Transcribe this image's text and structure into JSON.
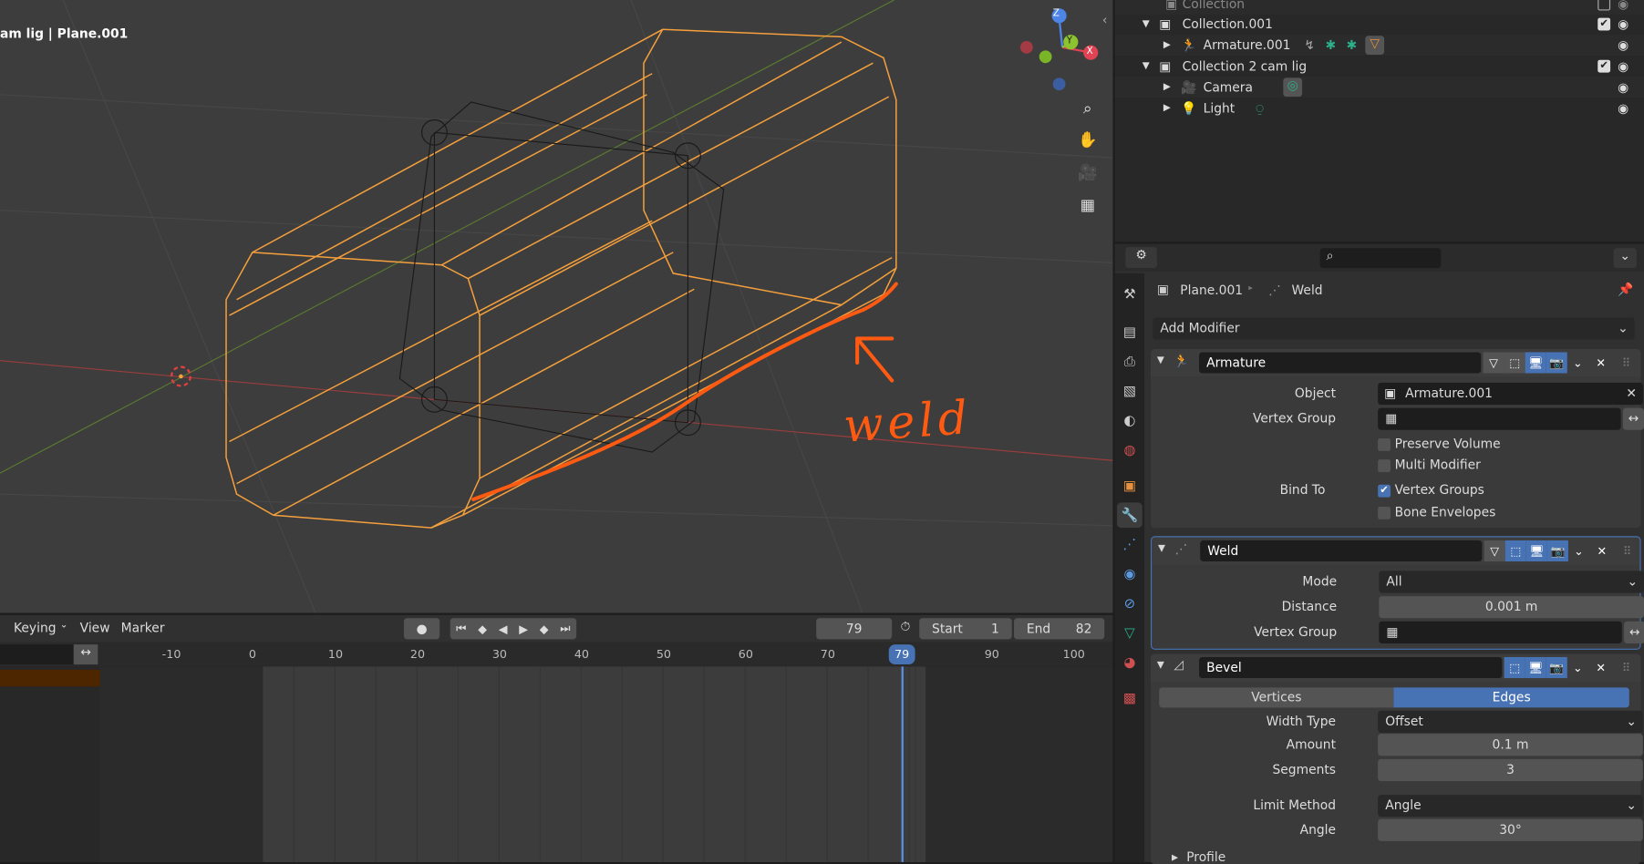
{
  "viewport": {
    "title": "am lig | Plane.001",
    "annotation": "weld",
    "gizmo": {
      "x": "X",
      "y": "Y",
      "z": "Z"
    },
    "nav_icons": [
      "zoom-icon",
      "hand-pan-icon",
      "camera-view-icon",
      "grid-ortho-icon"
    ]
  },
  "timeline": {
    "menus": [
      "Keying",
      "View",
      "Marker"
    ],
    "current_frame": "79",
    "start_label": "Start",
    "start": "1",
    "end_label": "End",
    "end": "82",
    "ticks": [
      "-10",
      "0",
      "10",
      "20",
      "30",
      "40",
      "50",
      "60",
      "70",
      "90",
      "100"
    ],
    "playhead": "79"
  },
  "outliner": {
    "rows": [
      {
        "label": "Collection",
        "icon": "collection-icon"
      },
      {
        "label": "Collection.001",
        "icon": "collection-icon"
      },
      {
        "label": "Armature.001",
        "icon": "armature-icon"
      },
      {
        "label": "Collection 2 cam lig",
        "icon": "collection-icon"
      },
      {
        "label": "Camera",
        "icon": "camera-icon"
      },
      {
        "label": "Light",
        "icon": "light-icon"
      }
    ]
  },
  "properties": {
    "breadcrumb": {
      "object": "Plane.001",
      "modifier": "Weld"
    },
    "add_modifier": "Add Modifier",
    "armature": {
      "name": "Armature",
      "object_label": "Object",
      "object": "Armature.001",
      "vgroup_label": "Vertex Group",
      "preserve_volume": "Preserve Volume",
      "multi_modifier": "Multi Modifier",
      "bind_to": "Bind To",
      "vertex_groups": "Vertex Groups",
      "bone_envelopes": "Bone Envelopes",
      "vertex_groups_checked": true
    },
    "weld": {
      "name": "Weld",
      "mode_label": "Mode",
      "mode": "All",
      "distance_label": "Distance",
      "distance": "0.001 m",
      "vgroup_label": "Vertex Group"
    },
    "bevel": {
      "name": "Bevel",
      "tab_vertices": "Vertices",
      "tab_edges": "Edges",
      "active_tab": "Edges",
      "width_type_label": "Width Type",
      "width_type": "Offset",
      "amount_label": "Amount",
      "amount": "0.1 m",
      "segments_label": "Segments",
      "segments": "3",
      "limit_label": "Limit Method",
      "limit": "Angle",
      "angle_label": "Angle",
      "angle": "30°",
      "profile": "Profile"
    }
  },
  "colors": {
    "accent": "#4772b3",
    "selection": "#f5a03c",
    "annotation": "#ff5a12"
  }
}
